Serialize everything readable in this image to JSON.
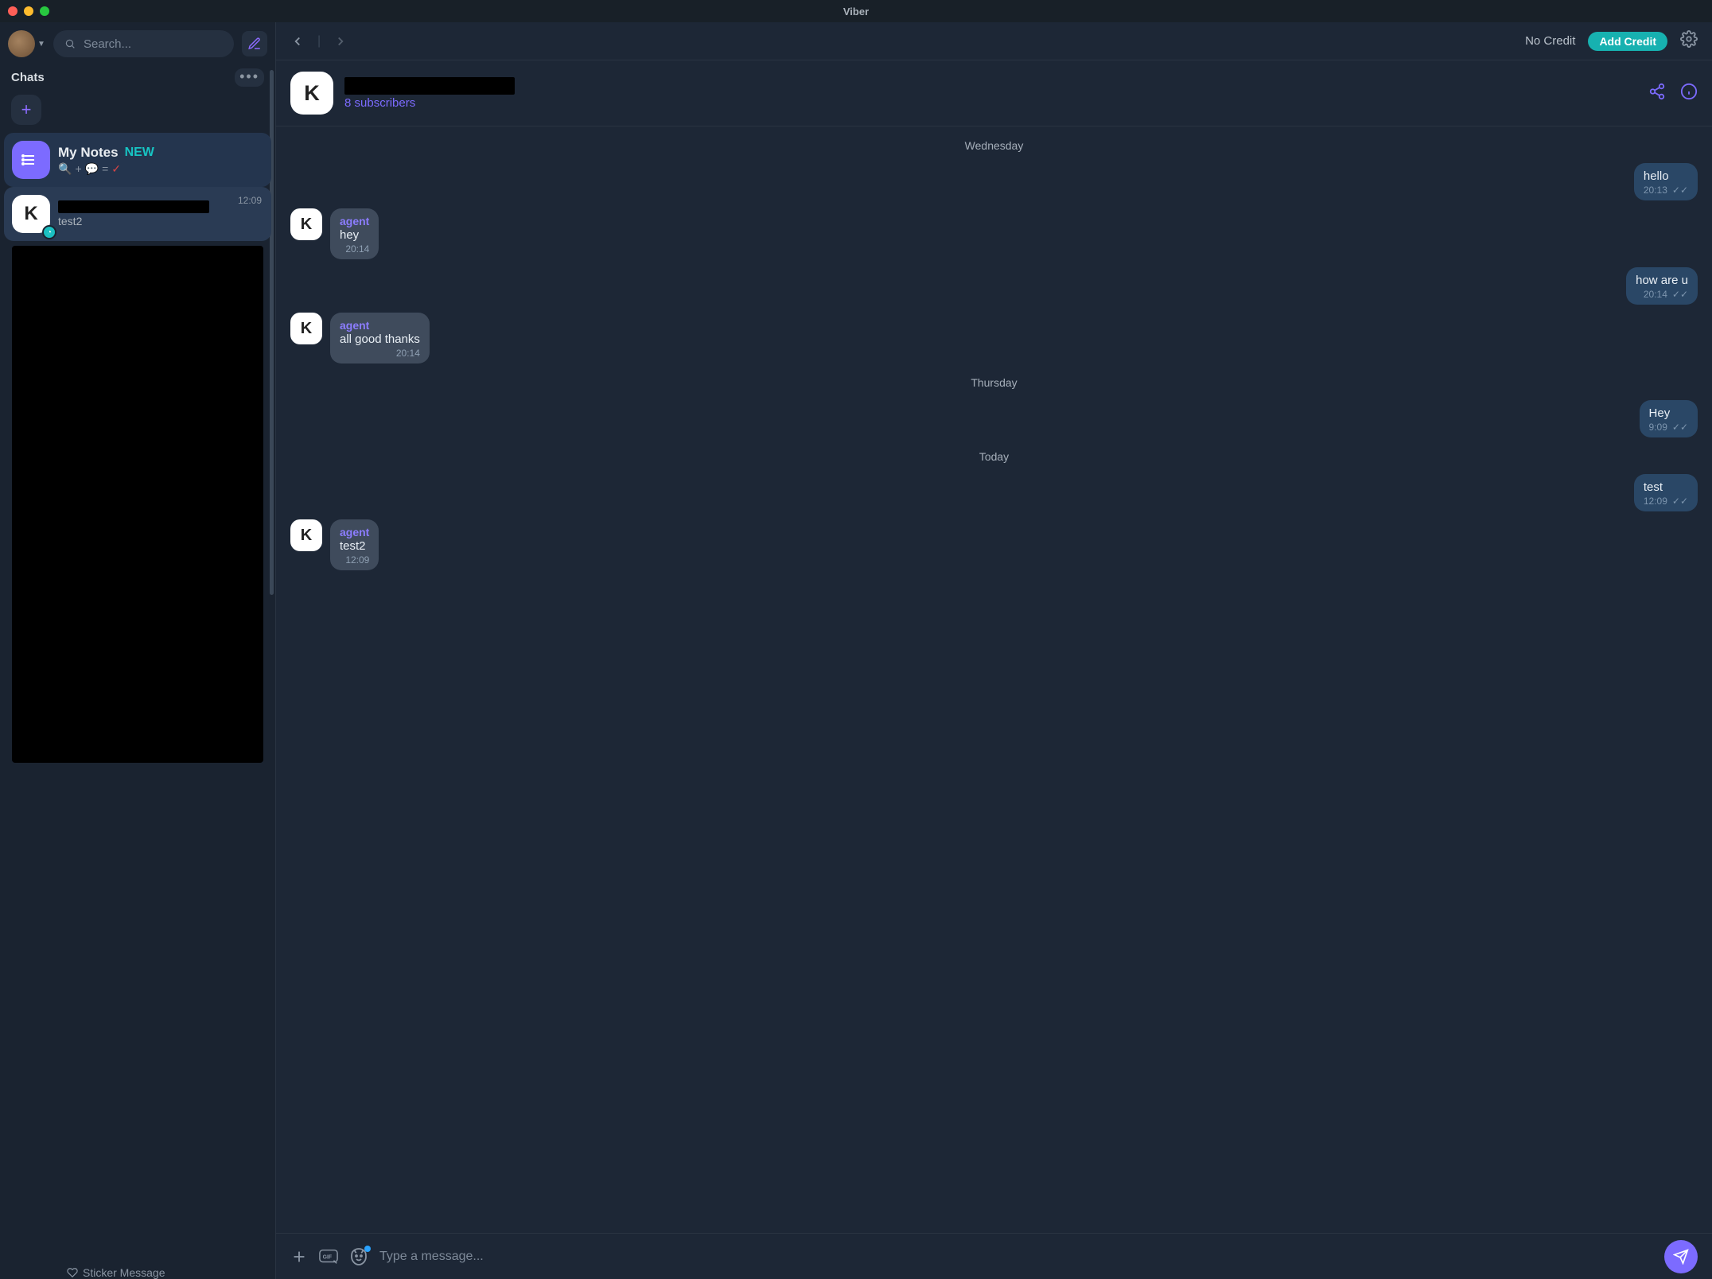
{
  "window": {
    "title": "Viber"
  },
  "sidebar": {
    "search_placeholder": "Search...",
    "header_label": "Chats",
    "items": [
      {
        "name": "My Notes",
        "badge": "NEW",
        "sub_emoji": "🔍 + 💬 = ✓",
        "avatar_letter": ""
      },
      {
        "name": "",
        "time": "12:09",
        "sub": "test2",
        "avatar_letter": "K"
      }
    ],
    "sticker_label": "Sticker Message"
  },
  "topbar": {
    "no_credit": "No Credit",
    "add_credit": "Add Credit"
  },
  "chat_header": {
    "avatar_letter": "K",
    "subscribers": "8 subscribers"
  },
  "messages": {
    "groups": [
      {
        "date": "Wednesday",
        "items": [
          {
            "dir": "out",
            "text": "hello",
            "time": "20:13"
          },
          {
            "dir": "in",
            "sender": "agent",
            "text": "hey",
            "time": "20:14",
            "avatar": "K"
          },
          {
            "dir": "out",
            "text": "how are u",
            "time": "20:14"
          },
          {
            "dir": "in",
            "sender": "agent",
            "text": "all good thanks",
            "time": "20:14",
            "avatar": "K"
          }
        ]
      },
      {
        "date": "Thursday",
        "items": [
          {
            "dir": "out",
            "text": "Hey",
            "time": "9:09"
          }
        ]
      },
      {
        "date": "Today",
        "items": [
          {
            "dir": "out",
            "text": "test",
            "time": "12:09"
          },
          {
            "dir": "in",
            "sender": "agent",
            "text": "test2",
            "time": "12:09",
            "avatar": "K"
          }
        ]
      }
    ]
  },
  "composer": {
    "placeholder": "Type a message..."
  }
}
